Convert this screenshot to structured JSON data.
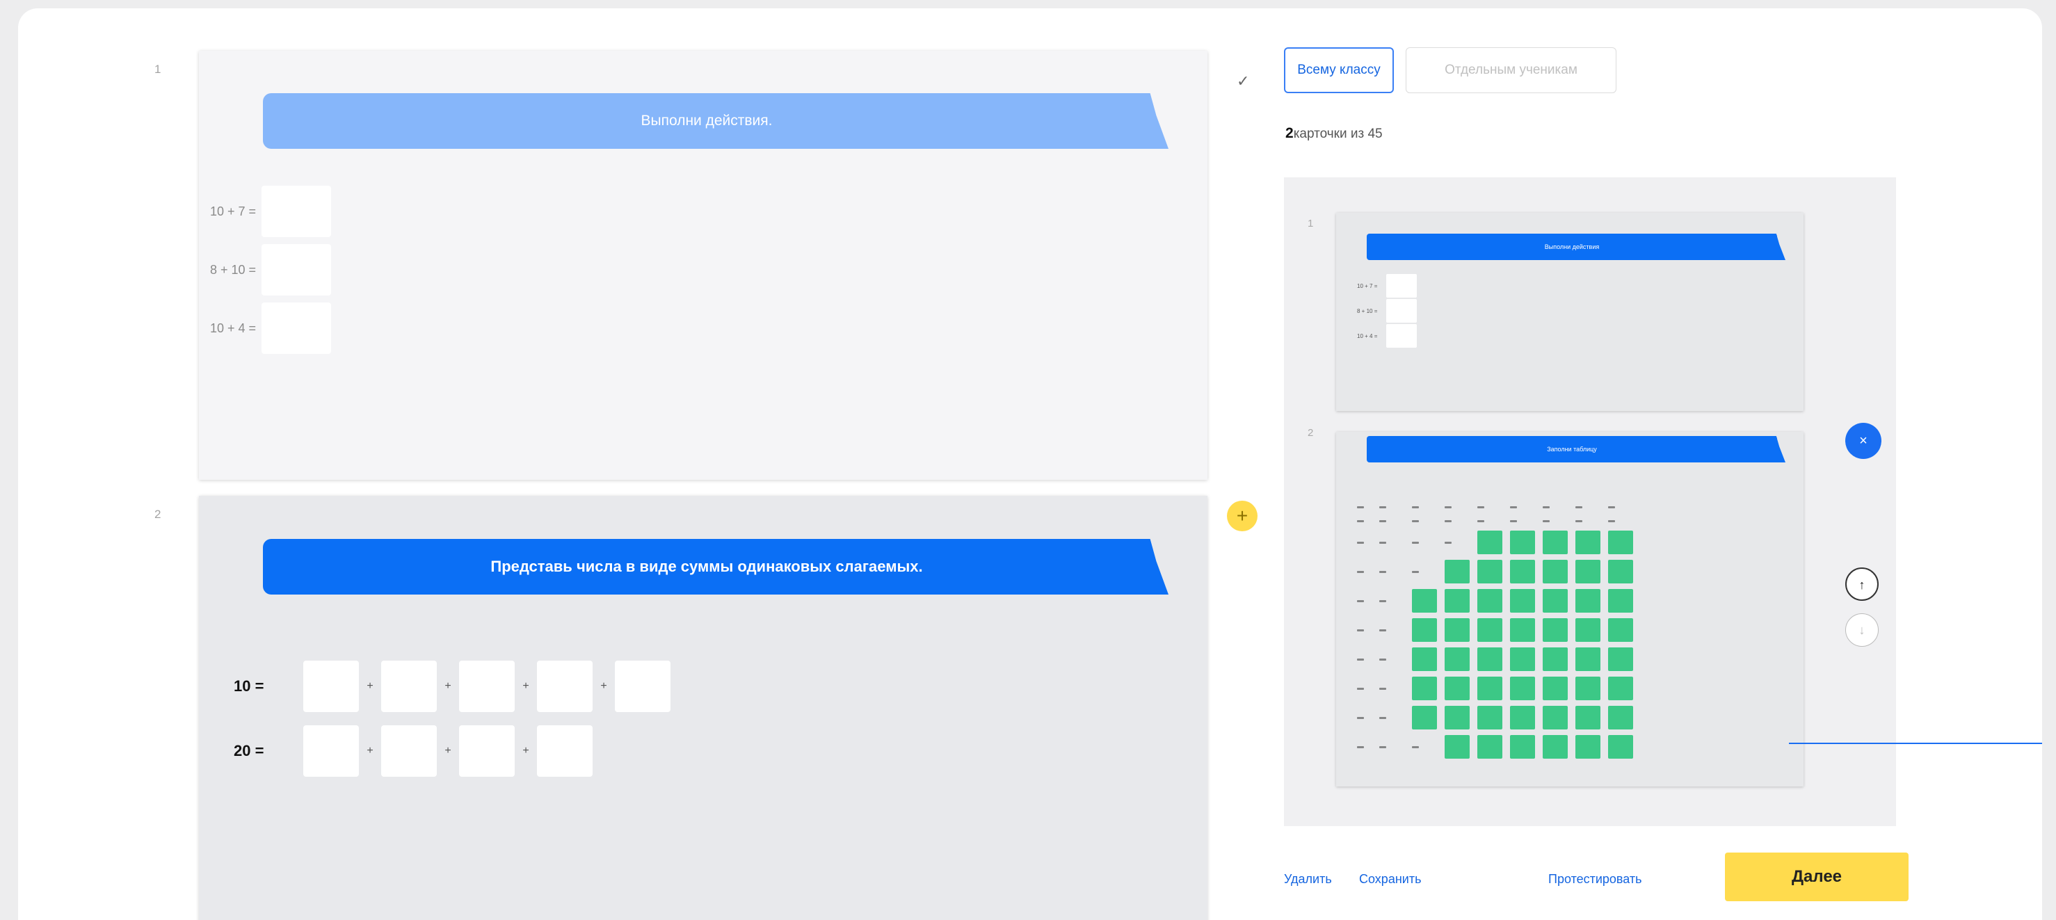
{
  "editor": {
    "cards": [
      {
        "number": "1",
        "title": "Выполни действия.",
        "equations": [
          "10 + 7 =",
          "8 + 10 =",
          "10 + 4 ="
        ]
      },
      {
        "number": "2",
        "title": "Представь числа в виде суммы одинаковых слагаемых.",
        "sums": [
          {
            "label": "10  =",
            "plus": "+"
          },
          {
            "label": "20  =",
            "plus": "+"
          }
        ]
      }
    ],
    "add_icon": "+",
    "check_icon": "✓"
  },
  "sidebar": {
    "tabs": {
      "whole_class": "Всему классу",
      "individual": "Отдельным ученикам"
    },
    "count": {
      "selected": "2",
      "text": "карточки из 45"
    },
    "preview": {
      "card1": {
        "number": "1",
        "title": "Выполни действия",
        "equations": [
          "10 + 7 =",
          "8 + 10 =",
          "10 + 4 ="
        ]
      },
      "card2": {
        "number": "2",
        "title": "Заполни таблицу"
      }
    },
    "remove_icon": "×",
    "up_icon": "↑",
    "down_icon": "↓"
  },
  "footer": {
    "delete": "Удалить",
    "save": "Сохранить",
    "test": "Протестировать",
    "next": "Далее"
  }
}
